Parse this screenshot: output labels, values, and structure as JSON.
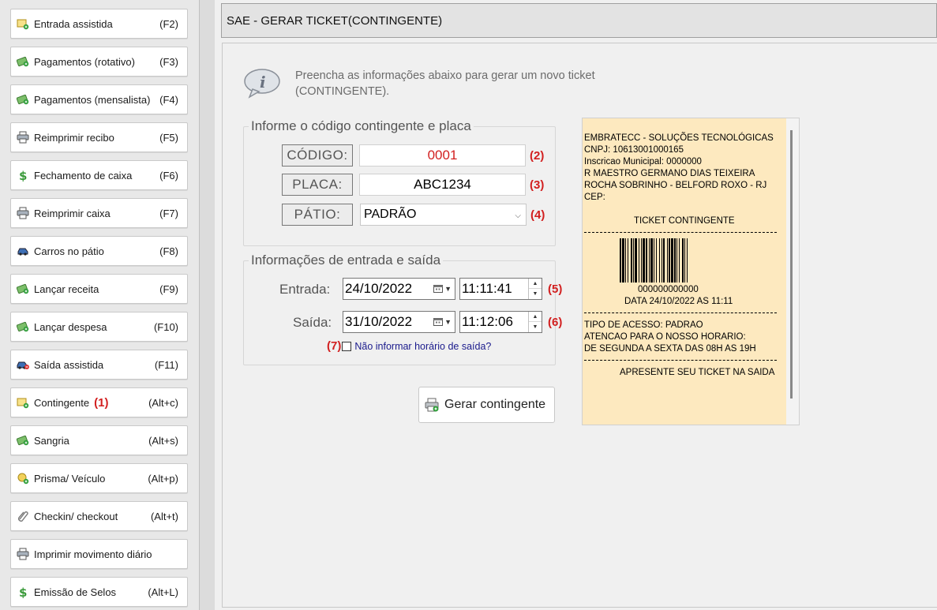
{
  "sidebar": {
    "items": [
      {
        "label": "Entrada assistida",
        "key": "(F2)",
        "icon": "ticket-in-icon"
      },
      {
        "label": "Pagamentos (rotativo)",
        "key": "(F3)",
        "icon": "money-icon"
      },
      {
        "label": "Pagamentos (mensalista)",
        "key": "(F4)",
        "icon": "money-icon"
      },
      {
        "label": "Reimprimir recibo",
        "key": "(F5)",
        "icon": "printer-icon"
      },
      {
        "label": "Fechamento de caixa",
        "key": "(F6)",
        "icon": "dollar-icon"
      },
      {
        "label": "Reimprimir caixa",
        "key": "(F7)",
        "icon": "printer-icon"
      },
      {
        "label": "Carros no pátio",
        "key": "(F8)",
        "icon": "car-icon"
      },
      {
        "label": "Lançar receita",
        "key": "(F9)",
        "icon": "money-icon"
      },
      {
        "label": "Lançar despesa",
        "key": "(F10)",
        "icon": "money-icon"
      },
      {
        "label": "Saída assistida",
        "key": "(F11)",
        "icon": "car-out-icon"
      },
      {
        "label": "Contingente",
        "key": "(Alt+c)",
        "icon": "ticket-in-icon",
        "badge": "(1)"
      },
      {
        "label": "Sangria",
        "key": "(Alt+s)",
        "icon": "money-icon"
      },
      {
        "label": "Prisma/ Veículo",
        "key": "(Alt+p)",
        "icon": "prism-icon"
      },
      {
        "label": "Checkin/ checkout",
        "key": "(Alt+t)",
        "icon": "paperclip-icon"
      },
      {
        "label": "Imprimir movimento diário",
        "key": "",
        "icon": "printer-icon"
      },
      {
        "label": "Emissão de Selos",
        "key": "(Alt+L)",
        "icon": "dollar-icon"
      }
    ]
  },
  "header": {
    "title": "SAE - GERAR TICKET(CONTINGENTE)"
  },
  "info": {
    "line1": "Preencha as informações abaixo para gerar um novo ticket",
    "line2": "(CONTINGENTE)."
  },
  "codigo_group": {
    "legend": "Informe o código contingente e placa",
    "codigo_label": "CÓDIGO:",
    "codigo_value": "0001",
    "codigo_badge": "(2)",
    "placa_label": "PLACA:",
    "placa_value": "ABC1234",
    "placa_badge": "(3)",
    "patio_label": "PÁTIO:",
    "patio_value": "PADRÃO",
    "patio_badge": "(4)"
  },
  "entrada_group": {
    "legend": "Informações de entrada e saída",
    "entrada_label": "Entrada:",
    "entrada_date": "24/10/2022",
    "entrada_time": "11:11:41",
    "entrada_badge": "(5)",
    "saida_label": "Saída:",
    "saida_date": "31/10/2022",
    "saida_time": "11:12:06",
    "saida_badge": "(6)",
    "checkbox_badge": "(7)",
    "checkbox_label": "Não informar horário de saída?",
    "checkbox_checked": false
  },
  "generate_button": {
    "label": "Gerar contingente"
  },
  "ticket": {
    "company": "EMBRATECC - SOLUÇÕES TECNOLÓGICAS",
    "cnpj": "CNPJ: 10613001000165",
    "inscricao": "Inscricao Municipal: 0000000",
    "address1": "R MAESTRO GERMANO DIAS TEIXEIRA",
    "address2": "ROCHA SOBRINHO - BELFORD ROXO - RJ",
    "cep": "CEP:",
    "title": "TICKET CONTINGENTE",
    "barcode_number": "000000000000",
    "data": "DATA 24/10/2022  AS 11:11",
    "acesso": "TIPO DE ACESSO: PADRAO",
    "atencao": "ATENCAO PARA O NOSSO HORARIO:",
    "horario": "DE SEGUNDA A SEXTA DAS 08H AS 19H",
    "footer": "APRESENTE SEU TICKET NA SAIDA"
  },
  "colors": {
    "accent_red": "#d21f1f",
    "ticket_bg": "#fde9bf",
    "link_blue": "#1a1a8c"
  }
}
